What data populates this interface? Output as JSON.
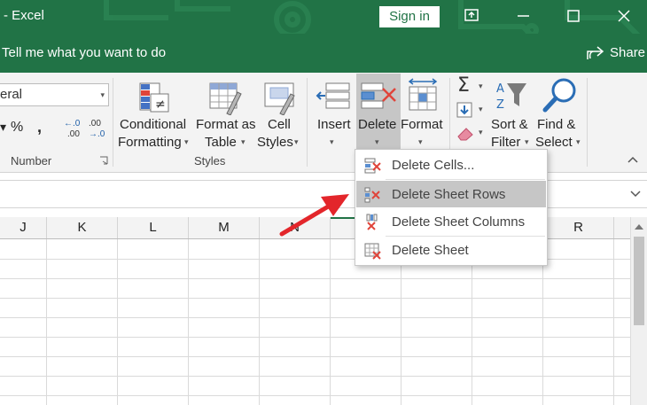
{
  "titlebar": {
    "title": "- Excel",
    "signin_label": "Sign in"
  },
  "tellme": {
    "text": "Tell me what you want to do",
    "share_label": "Share"
  },
  "ribbon": {
    "number_format_value": "eral",
    "percent_label": "%",
    "comma_label": ",",
    "increase_decimal_top": "←.0",
    "increase_decimal_bottom": ".00",
    "decrease_decimal_top": ".00",
    "decrease_decimal_bottom": "→.0",
    "number_group_label": "Number",
    "styles_group_label": "Styles",
    "conditional_formatting_line1": "Conditional",
    "conditional_formatting_line2": "Formatting",
    "format_as_table_line1": "Format as",
    "format_as_table_line2": "Table",
    "cell_styles_line1": "Cell",
    "cell_styles_line2": "Styles",
    "insert_label": "Insert",
    "delete_label": "Delete",
    "format_label": "Format",
    "sort_filter_line1": "Sort &",
    "sort_filter_line2": "Filter",
    "find_select_line1": "Find &",
    "find_select_line2": "Select",
    "caret": "▾",
    "sigma": "Σ"
  },
  "grid": {
    "columns": [
      "J",
      "K",
      "L",
      "M",
      "N",
      "",
      "",
      "",
      "R"
    ]
  },
  "delete_menu": {
    "items": [
      {
        "label": "Delete Cells...",
        "icon": "delete-cells-icon"
      },
      {
        "label": "Delete Sheet Rows",
        "icon": "delete-rows-icon"
      },
      {
        "label": "Delete Sheet Columns",
        "icon": "delete-columns-icon"
      },
      {
        "label": "Delete Sheet",
        "icon": "delete-sheet-icon"
      }
    ]
  },
  "colors": {
    "excel_green": "#217346",
    "delete_x_red": "#e0443a",
    "highlight_gray": "#c6c6c6",
    "arrow_red": "#e3262b"
  }
}
